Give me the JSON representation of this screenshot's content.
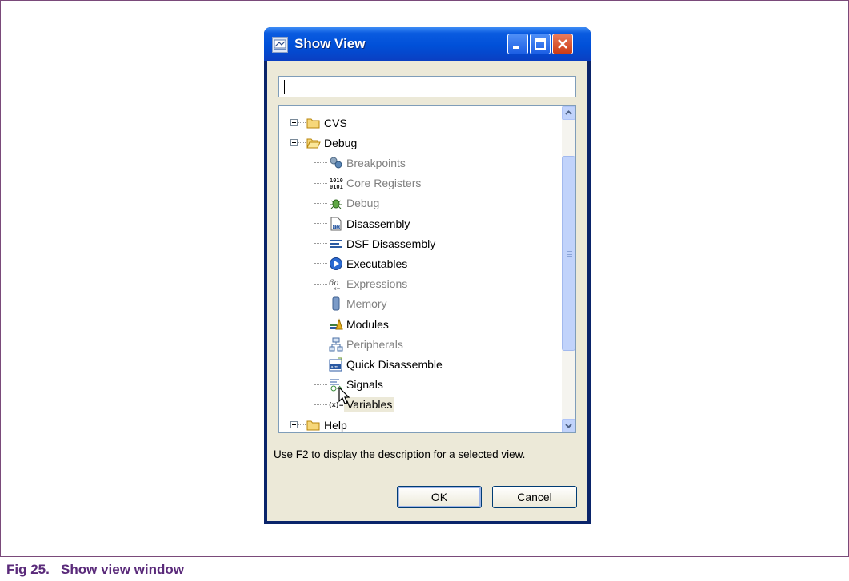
{
  "dialog": {
    "title": "Show View",
    "search": {
      "value": "",
      "placeholder": ""
    },
    "tree": [
      {
        "label": "CVS",
        "level": 0,
        "toggle": "+",
        "icon": "folder-icon",
        "enabled": true
      },
      {
        "label": "Debug",
        "level": 0,
        "toggle": "-",
        "icon": "folder-open-icon",
        "enabled": true
      },
      {
        "label": "Breakpoints",
        "level": 1,
        "icon": "breakpoints-icon",
        "enabled": false
      },
      {
        "label": "Core Registers",
        "level": 1,
        "icon": "registers-icon",
        "enabled": false
      },
      {
        "label": "Debug",
        "level": 1,
        "icon": "debug-bug-icon",
        "enabled": false
      },
      {
        "label": "Disassembly",
        "level": 1,
        "icon": "disassembly-icon",
        "enabled": true
      },
      {
        "label": "DSF Disassembly",
        "level": 1,
        "icon": "dsf-disassembly-icon",
        "enabled": true
      },
      {
        "label": "Executables",
        "level": 1,
        "icon": "executables-icon",
        "enabled": true
      },
      {
        "label": "Expressions",
        "level": 1,
        "icon": "expressions-icon",
        "enabled": false
      },
      {
        "label": "Memory",
        "level": 1,
        "icon": "memory-icon",
        "enabled": false
      },
      {
        "label": "Modules",
        "level": 1,
        "icon": "modules-icon",
        "enabled": true
      },
      {
        "label": "Peripherals",
        "level": 1,
        "icon": "peripherals-icon",
        "enabled": false
      },
      {
        "label": "Quick Disassemble",
        "level": 1,
        "icon": "quick-disassemble-icon",
        "enabled": true
      },
      {
        "label": "Signals",
        "level": 1,
        "icon": "signals-icon",
        "enabled": true
      },
      {
        "label": "Variables",
        "level": 1,
        "icon": "variables-icon",
        "enabled": true,
        "highlighted": true
      },
      {
        "label": "Help",
        "level": 0,
        "toggle": "+",
        "icon": "folder-icon",
        "enabled": true
      }
    ],
    "hint": "Use F2 to display the description for a selected view.",
    "ok_label": "OK",
    "cancel_label": "Cancel"
  },
  "caption": {
    "figure": "Fig 25.",
    "text": "Show view window"
  },
  "colors": {
    "titlebar": "#0050d8",
    "caption_text": "#5a2a7a",
    "dialog_bg": "#ece9d8",
    "disabled_text": "#808080"
  }
}
